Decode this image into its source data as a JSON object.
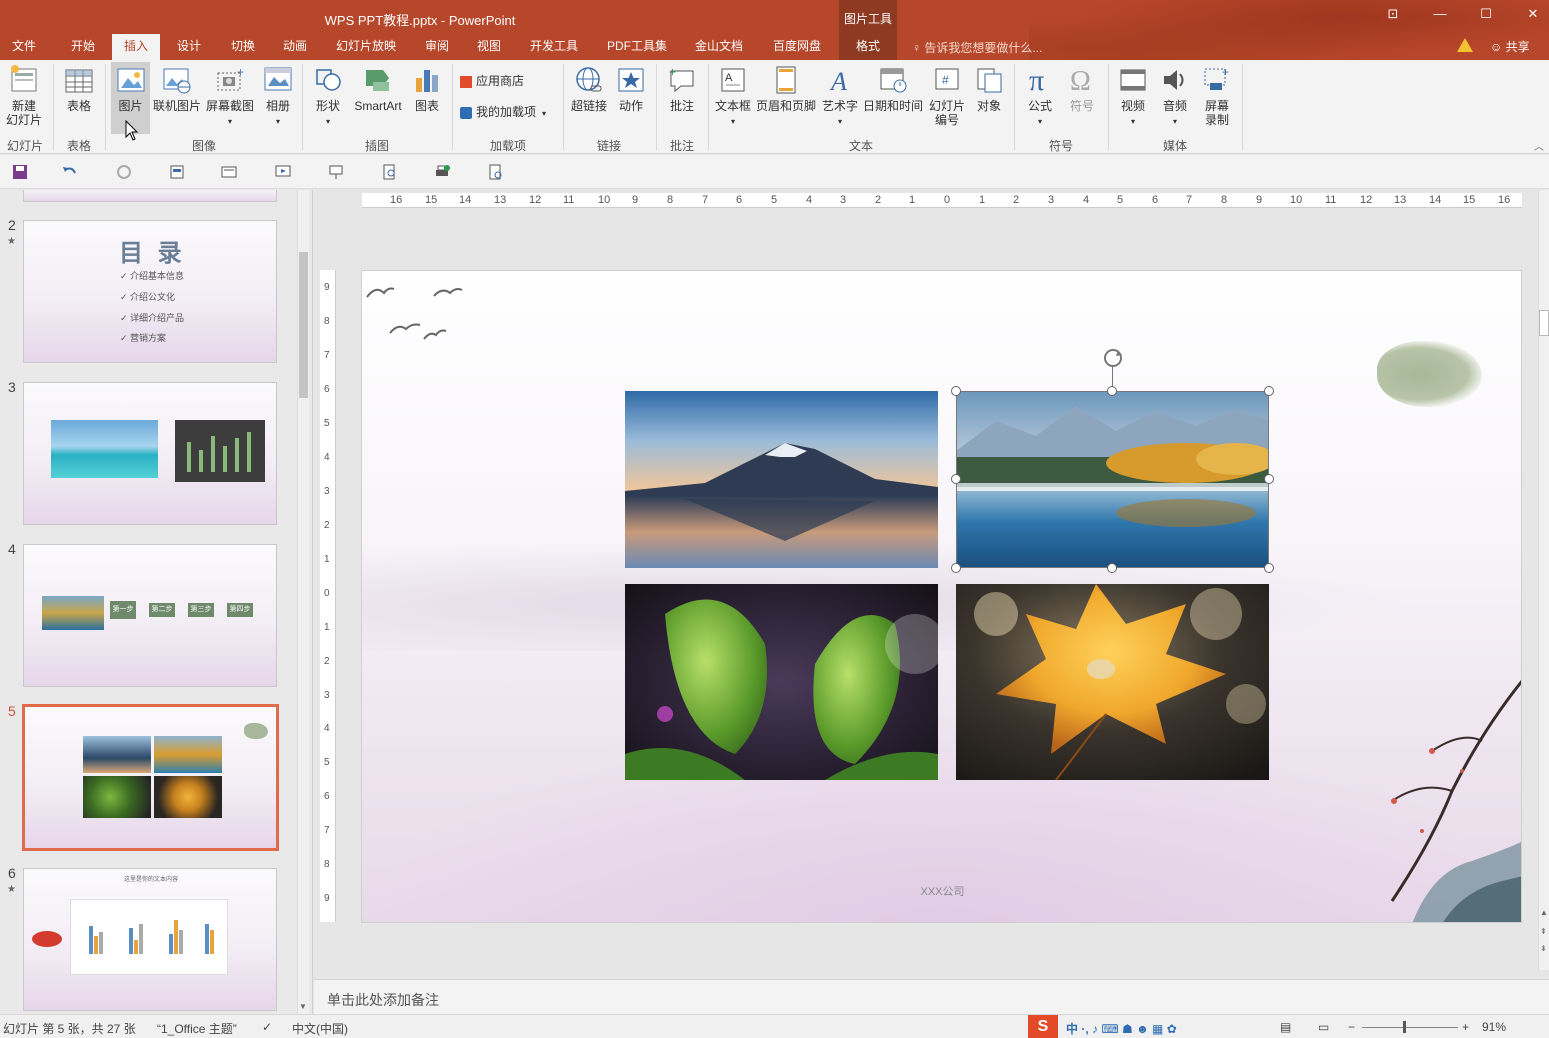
{
  "window": {
    "title": "WPS PPT教程.pptx - PowerPoint",
    "context_tool_label": "图片工具",
    "buttons": [
      "restore-ribbon",
      "minimize",
      "maximize",
      "close"
    ]
  },
  "tabs": [
    "文件",
    "开始",
    "插入",
    "设计",
    "切换",
    "动画",
    "幻灯片放映",
    "审阅",
    "视图",
    "开发工具",
    "PDF工具集",
    "金山文档",
    "百度网盘",
    "格式"
  ],
  "active_tab": "插入",
  "tell_me": "告诉我您想要做什么...",
  "share": "共享",
  "ribbon": {
    "buttons": {
      "new_slide": "新建\n幻灯片",
      "table": "表格",
      "picture": "图片",
      "online_picture": "联机图片",
      "screenshot": "屏幕截图",
      "album": "相册",
      "shapes": "形状",
      "smartart": "SmartArt",
      "chart": "图表",
      "app_store": "应用商店",
      "my_addins": "我的加载项",
      "hyperlink": "超链接",
      "action": "动作",
      "comment": "批注",
      "textbox": "文本框",
      "header_footer": "页眉和页脚",
      "wordart": "艺术字",
      "datetime": "日期和时间",
      "slide_number": "幻灯片\n编号",
      "object": "对象",
      "equation": "公式",
      "symbol": "符号",
      "video": "视频",
      "audio": "音频",
      "screen_recording": "屏幕\n录制"
    },
    "groups": {
      "slides": "幻灯片",
      "tables": "表格",
      "images": "图像",
      "illustrations": "插图",
      "addins": "加载项",
      "links": "链接",
      "comments": "批注",
      "text": "文本",
      "symbols": "符号",
      "media": "媒体"
    }
  },
  "thumbnails": {
    "numbers": [
      "2",
      "3",
      "4",
      "5",
      "6"
    ],
    "active": "5",
    "slide2_title": "目 录",
    "slide2_items": [
      "✓ 介绍基本信息",
      "✓ 介绍公文化",
      "✓ 详细介绍产品",
      "✓ 营销方案"
    ],
    "slide4_steps": [
      "第一步",
      "第二步",
      "第三步",
      "第四步"
    ],
    "slide6_title": "这里是你的文本内容"
  },
  "slide": {
    "footer": "XXX公司"
  },
  "notes_placeholder": "单击此处添加备注",
  "status": {
    "slide_info": "幻灯片 第 5 张，共 27 张",
    "theme": "“1_Office 主题”",
    "language": "中文(中国)",
    "zoom": "91%"
  },
  "ruler_h": [
    "16",
    "15",
    "14",
    "13",
    "12",
    "11",
    "10",
    "9",
    "8",
    "7",
    "6",
    "5",
    "4",
    "3",
    "2",
    "1",
    "0",
    "1",
    "2",
    "3",
    "4",
    "5",
    "6",
    "7",
    "8",
    "9",
    "10",
    "11",
    "12",
    "13",
    "14",
    "15",
    "16"
  ],
  "ruler_v": [
    "9",
    "8",
    "7",
    "6",
    "5",
    "4",
    "3",
    "2",
    "1",
    "0",
    "1",
    "2",
    "3",
    "4",
    "5",
    "6",
    "7",
    "8",
    "9"
  ],
  "colors": {
    "accent": "#b7472a",
    "thumbnail_selection": "#e06b4b"
  }
}
